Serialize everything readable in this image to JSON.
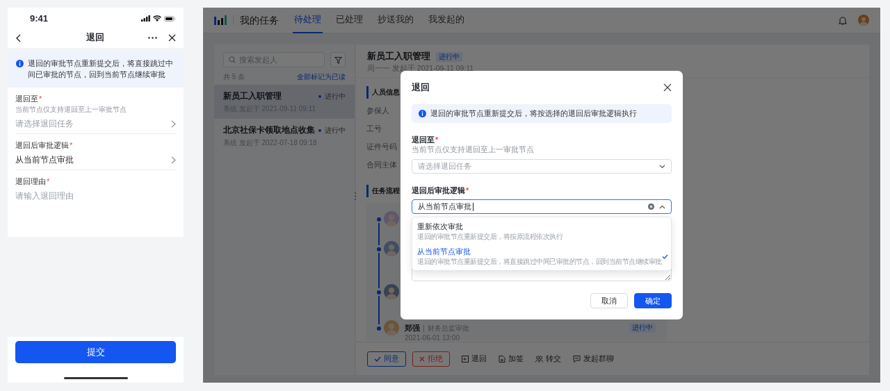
{
  "mobile": {
    "status_bar": {
      "time": "9:41"
    },
    "nav": {
      "title": "退回"
    },
    "notice": "退回的审批节点重新提交后，将直接跳过中间已审批的节点，回到当前节点继续审批",
    "fields": [
      {
        "kind": "picker",
        "label": "退回至",
        "mark": "*",
        "hint": "当前节点仅支持退回至上一审批节点",
        "placeholder": "请选择退回任务"
      },
      {
        "kind": "picker",
        "label": "退回后审批逻辑",
        "mark": "*",
        "value": "从当前节点审批"
      },
      {
        "kind": "textarea",
        "label": "退回理由",
        "mark": "*",
        "placeholder": "请输入退回理由"
      }
    ],
    "submit": "提交"
  },
  "desktop": {
    "title": "我的任务",
    "tabs": [
      {
        "label": "待处理",
        "selected": true
      },
      {
        "label": "已处理",
        "selected": false
      },
      {
        "label": "抄送我的",
        "selected": false
      },
      {
        "label": "我发起的",
        "selected": false
      }
    ],
    "list": {
      "search_placeholder": "搜索发起人",
      "count": "共 5 条",
      "mark_all": "全部标记为已读",
      "items": [
        {
          "title": "新员工入职管理",
          "status": "进行中",
          "meta": "系统 发起于 2021-09-11 09:11",
          "selected": true
        },
        {
          "title": "北京社保卡领取地点收集",
          "status": "进行中",
          "meta": "系统 发起于 2022-07-18 09:18",
          "selected": false
        }
      ]
    },
    "detail": {
      "title": "新员工入职管理",
      "status": "进行中",
      "meta": "周一一 发起于 2021-09-11 09:11",
      "info_title": "人员信息",
      "info_labels": [
        "参保人",
        "工号",
        "证件号码",
        "合同主体"
      ],
      "flow_title": "任务流程",
      "timeline": [
        {
          "kind": "avatar-only"
        },
        {
          "kind": "avatar-only"
        },
        {
          "kind": "avatar-only"
        },
        {
          "kind": "full",
          "name": "郑强",
          "separator": "|",
          "role": "财务总监审批",
          "time": "2021-06-01 13:00",
          "status": "进行中"
        }
      ],
      "actions": [
        {
          "kind": "approve",
          "label": "同意"
        },
        {
          "kind": "reject",
          "label": "拒绝"
        },
        {
          "kind": "return",
          "label": "退回"
        },
        {
          "kind": "add-sign",
          "label": "加签"
        },
        {
          "kind": "transfer",
          "label": "转交"
        },
        {
          "kind": "chat",
          "label": "发起群聊"
        }
      ]
    }
  },
  "dialog": {
    "title": "退回",
    "notice": "退回的审批节点重新提交后，将按选择的退回后审批逻辑执行",
    "fields": [
      {
        "kind": "select",
        "label": "退回至",
        "mark": "*",
        "hint": "当前节点仅支持退回至上一审批节点",
        "placeholder": "请选择退回任务"
      },
      {
        "kind": "combobox",
        "label": "退回后审批逻辑",
        "mark": "*",
        "value": "从当前节点审批",
        "expanded": true,
        "options": [
          {
            "label": "重新依次审批",
            "description": "退回的审批节点重新提交后，将按原流程依次执行",
            "selected": false
          },
          {
            "label": "从当前节点审批",
            "description": "退回的审批节点重新提交后，将直接跳过中间已审批的节点，回到当前节点继续审批",
            "selected": true
          }
        ]
      },
      {
        "kind": "textarea"
      }
    ],
    "buttons": [
      {
        "kind": "secondary",
        "label": "取消"
      },
      {
        "kind": "primary",
        "label": "确定"
      }
    ]
  }
}
